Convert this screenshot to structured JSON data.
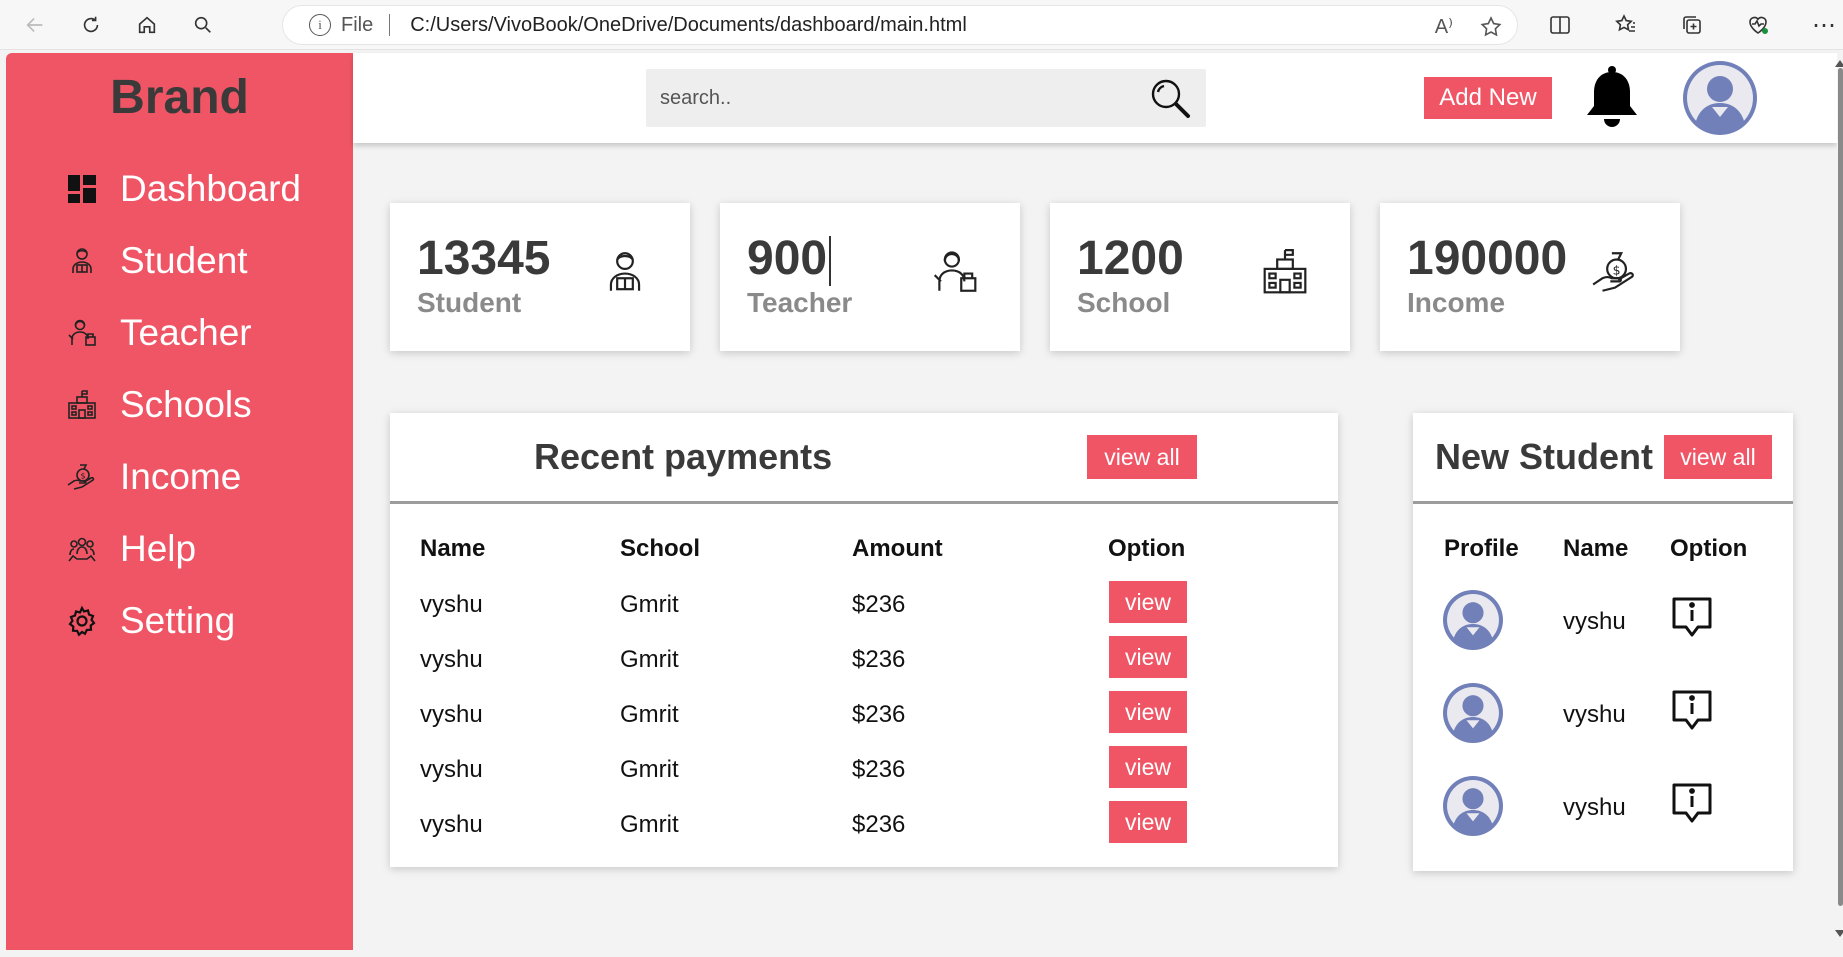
{
  "browser": {
    "file_label": "File",
    "url": "C:/Users/VivoBook/OneDrive/Documents/dashboard/main.html",
    "read_aloud": "A⁾"
  },
  "sidebar": {
    "brand": "Brand",
    "items": [
      {
        "label": "Dashboard",
        "icon": "dashboard-icon"
      },
      {
        "label": "Student",
        "icon": "student-icon"
      },
      {
        "label": "Teacher",
        "icon": "teacher-icon"
      },
      {
        "label": "Schools",
        "icon": "school-icon"
      },
      {
        "label": "Income",
        "icon": "income-icon"
      },
      {
        "label": "Help",
        "icon": "help-icon"
      },
      {
        "label": "Setting",
        "icon": "gear-icon"
      }
    ]
  },
  "topbar": {
    "search_placeholder": "search..",
    "add_new": "Add New"
  },
  "cards": [
    {
      "value": "13345",
      "label": "Student",
      "icon": "student-icon"
    },
    {
      "value": "900",
      "label": "Teacher",
      "icon": "teacher-icon"
    },
    {
      "value": "1200",
      "label": "School",
      "icon": "school-icon"
    },
    {
      "value": "190000",
      "label": "Income",
      "icon": "income-icon"
    }
  ],
  "payments": {
    "title": "Recent payments",
    "view_all": "view all",
    "headers": [
      "Name",
      "School",
      "Amount",
      "Option"
    ],
    "rows": [
      {
        "name": "vyshu",
        "school": "Gmrit",
        "amount": "$236",
        "option": "view"
      },
      {
        "name": "vyshu",
        "school": "Gmrit",
        "amount": "$236",
        "option": "view"
      },
      {
        "name": "vyshu",
        "school": "Gmrit",
        "amount": "$236",
        "option": "view"
      },
      {
        "name": "vyshu",
        "school": "Gmrit",
        "amount": "$236",
        "option": "view"
      },
      {
        "name": "vyshu",
        "school": "Gmrit",
        "amount": "$236",
        "option": "view"
      }
    ]
  },
  "new_student": {
    "title": "New Student",
    "view_all": "view all",
    "headers": [
      "Profile",
      "Name",
      "Option"
    ],
    "rows": [
      {
        "name": "vyshu",
        "option_icon": "info-icon"
      },
      {
        "name": "vyshu",
        "option_icon": "info-icon"
      },
      {
        "name": "vyshu",
        "option_icon": "info-icon"
      }
    ]
  },
  "colors": {
    "accent": "#f05565",
    "text_dark": "#3a3a3a",
    "avatar": "#6f7fb5"
  }
}
